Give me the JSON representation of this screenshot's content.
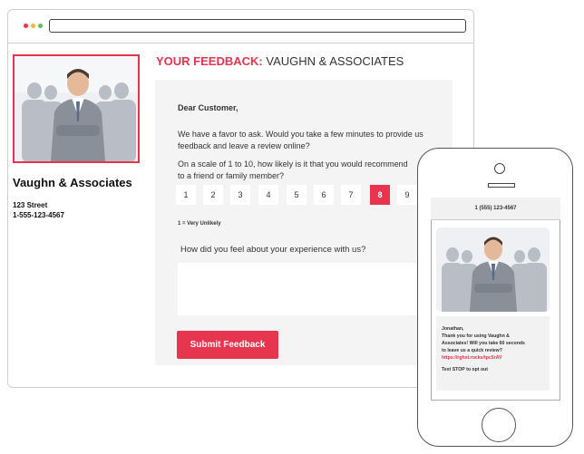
{
  "web": {
    "business_name": "Vaughn & Associates",
    "address_line": "123 Street",
    "phone": "1-555-123-4567",
    "heading_highlight": "YOUR FEEDBACK:",
    "heading_rest": "VAUGHN & ASSOCIATES",
    "greeting": "Dear Customer,",
    "paragraph_1a": "We have a favor to ask. Would you take a few minutes to provide us",
    "paragraph_1b": "feedback and leave a review online?",
    "paragraph_2a": "On a scale of 1 to 10, how likely is it that you would recommend",
    "paragraph_2b": "to a friend or family member?",
    "scale": [
      "1",
      "2",
      "3",
      "4",
      "5",
      "6",
      "7",
      "8",
      "9"
    ],
    "selected_score": "8",
    "scale_hint": "1 = Very Unlikely",
    "question": "How did you feel about your experience with us?",
    "textarea_value": "",
    "submit_label": "Submit Feedback"
  },
  "sms": {
    "phone_number": "1 (555) 123-4567",
    "name": "Jonathan,",
    "line1": "Thank you for using Vaughn &",
    "line2": "Associates! Will you take 60 seconds",
    "line3": "to leave us a quick review?",
    "link": "https://rghst.rocks/tpc5rAV",
    "opt_out": "Text STOP to opt out"
  },
  "colors": {
    "accent": "#e7344f",
    "panel": "#f4f4f4",
    "window_border": "#cfcfcf"
  },
  "icons": {
    "window_controls": "traffic-light-dots",
    "phone_camera": "circle",
    "phone_home": "home-button-circle"
  }
}
